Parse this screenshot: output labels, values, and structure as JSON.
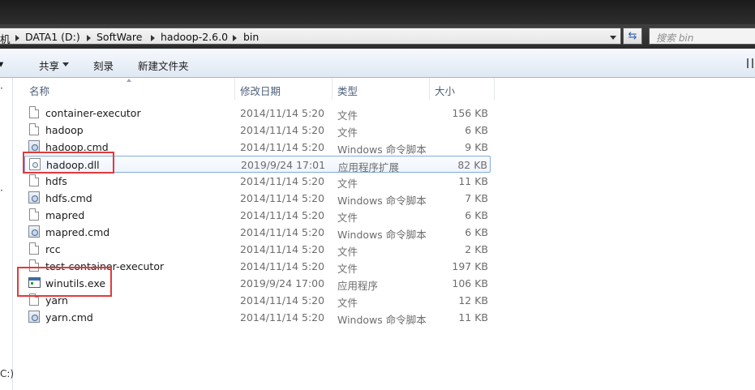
{
  "window": {
    "breadcrumb": [
      "机",
      "DATA1 (D:)",
      "SoftWare",
      "hadoop-2.6.0",
      "bin"
    ],
    "search_placeholder": "搜索 bin"
  },
  "toolbar": {
    "share": "共享",
    "burn": "刻录",
    "new_folder": "新建文件夹"
  },
  "nav": {
    "drive_fragment": "C:)"
  },
  "columns": {
    "name": "名称",
    "date": "修改日期",
    "type": "类型",
    "size": "大小"
  },
  "files": [
    {
      "name": "container-executor",
      "date": "2014/11/14 5:20",
      "type": "文件",
      "size": "156 KB",
      "icon": "file-icon"
    },
    {
      "name": "hadoop",
      "date": "2014/11/14 5:20",
      "type": "文件",
      "size": "6 KB",
      "icon": "file-icon"
    },
    {
      "name": "hadoop.cmd",
      "date": "2014/11/14 5:20",
      "type": "Windows 命令脚本",
      "size": "9 KB",
      "icon": "cmd-script-icon"
    },
    {
      "name": "hadoop.dll",
      "date": "2019/9/24 17:01",
      "type": "应用程序扩展",
      "size": "82 KB",
      "icon": "dll-icon"
    },
    {
      "name": "hdfs",
      "date": "2014/11/14 5:20",
      "type": "文件",
      "size": "11 KB",
      "icon": "file-icon"
    },
    {
      "name": "hdfs.cmd",
      "date": "2014/11/14 5:20",
      "type": "Windows 命令脚本",
      "size": "7 KB",
      "icon": "cmd-script-icon"
    },
    {
      "name": "mapred",
      "date": "2014/11/14 5:20",
      "type": "文件",
      "size": "6 KB",
      "icon": "file-icon"
    },
    {
      "name": "mapred.cmd",
      "date": "2014/11/14 5:20",
      "type": "Windows 命令脚本",
      "size": "6 KB",
      "icon": "cmd-script-icon"
    },
    {
      "name": "rcc",
      "date": "2014/11/14 5:20",
      "type": "文件",
      "size": "2 KB",
      "icon": "file-icon"
    },
    {
      "name": "test-container-executor",
      "date": "2014/11/14 5:20",
      "type": "文件",
      "size": "197 KB",
      "icon": "file-icon"
    },
    {
      "name": "winutils.exe",
      "date": "2019/9/24 17:00",
      "type": "应用程序",
      "size": "106 KB",
      "icon": "exe-icon"
    },
    {
      "name": "yarn",
      "date": "2014/11/14 5:20",
      "type": "文件",
      "size": "12 KB",
      "icon": "file-icon"
    },
    {
      "name": "yarn.cmd",
      "date": "2014/11/14 5:20",
      "type": "Windows 命令脚本",
      "size": "11 KB",
      "icon": "cmd-script-icon"
    }
  ],
  "selected_file": "hadoop.dll",
  "highlighted_files": [
    "hadoop.dll",
    "winutils.exe"
  ],
  "colors": {
    "highlight_box": "#e23a3a",
    "selection_border": "#84acdd"
  }
}
